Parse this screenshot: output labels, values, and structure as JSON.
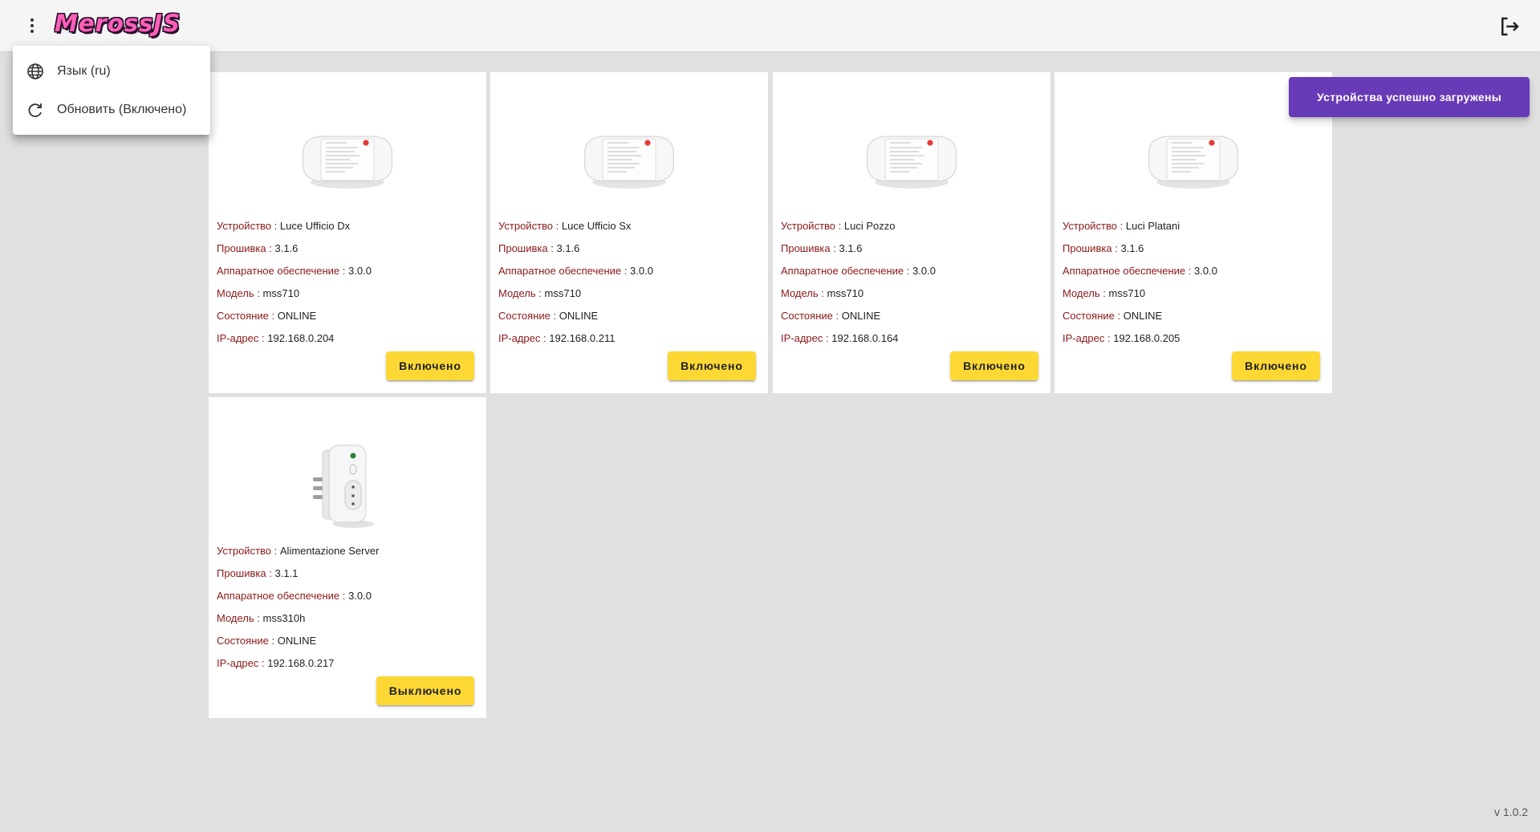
{
  "header": {
    "logo_text": "MerossJS",
    "menu_icon": "more-vert-icon",
    "logout_icon": "logout-icon"
  },
  "menu": {
    "items": [
      {
        "icon": "globe-icon",
        "label": "Язык (ru)"
      },
      {
        "icon": "refresh-icon",
        "label": "Обновить (Включено)"
      }
    ]
  },
  "labels": {
    "device": "Устройство",
    "firmware": "Прошивка",
    "hardware": "Аппаратное обеспечение",
    "model": "Модель",
    "state": "Состояние",
    "ip": "IP-адрес",
    "separator": ":"
  },
  "devices": [
    {
      "name": "Luce Ufficio Dx",
      "firmware": "3.1.6",
      "hardware": "3.0.0",
      "model": "mss710",
      "state": "ONLINE",
      "ip": "192.168.0.204",
      "button": "Включено"
    },
    {
      "name": "Luce Ufficio Sx",
      "firmware": "3.1.6",
      "hardware": "3.0.0",
      "model": "mss710",
      "state": "ONLINE",
      "ip": "192.168.0.211",
      "button": "Включено"
    },
    {
      "name": "Luci Pozzo",
      "firmware": "3.1.6",
      "hardware": "3.0.0",
      "model": "mss710",
      "state": "ONLINE",
      "ip": "192.168.0.164",
      "button": "Включено"
    },
    {
      "name": "Luci Platani",
      "firmware": "3.1.6",
      "hardware": "3.0.0",
      "model": "mss710",
      "state": "ONLINE",
      "ip": "192.168.0.205",
      "button": "Включено"
    },
    {
      "name": "Alimentazione Server",
      "firmware": "3.1.1",
      "hardware": "3.0.0",
      "model": "mss310h",
      "state": "ONLINE",
      "ip": "192.168.0.217",
      "button": "Выключено"
    }
  ],
  "notification": "Устройства успешно загружены",
  "version": "v 1.0.2",
  "colors": {
    "accent": "#673ab7",
    "button": "#fdd835",
    "label": "#8b1818",
    "logo": "#ff5fb8"
  }
}
